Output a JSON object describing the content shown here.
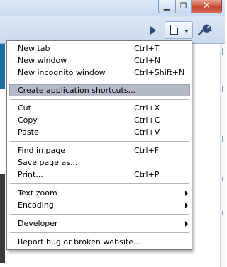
{
  "window_controls": {
    "minimize_icon": "minimize-icon",
    "maximize_icon": "restore-icon",
    "close_icon": "close-icon",
    "close_color": "#c7492d"
  },
  "menu": {
    "items": [
      {
        "label": "New tab",
        "shortcut": "Ctrl+T"
      },
      {
        "label": "New window",
        "shortcut": "Ctrl+N"
      },
      {
        "label": "New incognito window",
        "shortcut": "Ctrl+Shift+N"
      },
      {
        "label": "Create application shortcuts...",
        "shortcut": "",
        "highlighted": true
      },
      {
        "label": "Cut",
        "shortcut": "Ctrl+X"
      },
      {
        "label": "Copy",
        "shortcut": "Ctrl+C"
      },
      {
        "label": "Paste",
        "shortcut": "Ctrl+V"
      },
      {
        "label": "Find in page",
        "shortcut": "Ctrl+F"
      },
      {
        "label": "Save page as...",
        "shortcut": ""
      },
      {
        "label": "Print...",
        "shortcut": "Ctrl+P"
      },
      {
        "label": "Text zoom",
        "shortcut": "",
        "submenu": true
      },
      {
        "label": "Encoding",
        "shortcut": "",
        "submenu": true
      },
      {
        "label": "Developer",
        "shortcut": "",
        "submenu": true
      },
      {
        "label": "Report bug or broken website...",
        "shortcut": ""
      }
    ]
  },
  "colors": {
    "highlight": "#b4bac7",
    "titlebar": "#c9dcf2"
  }
}
